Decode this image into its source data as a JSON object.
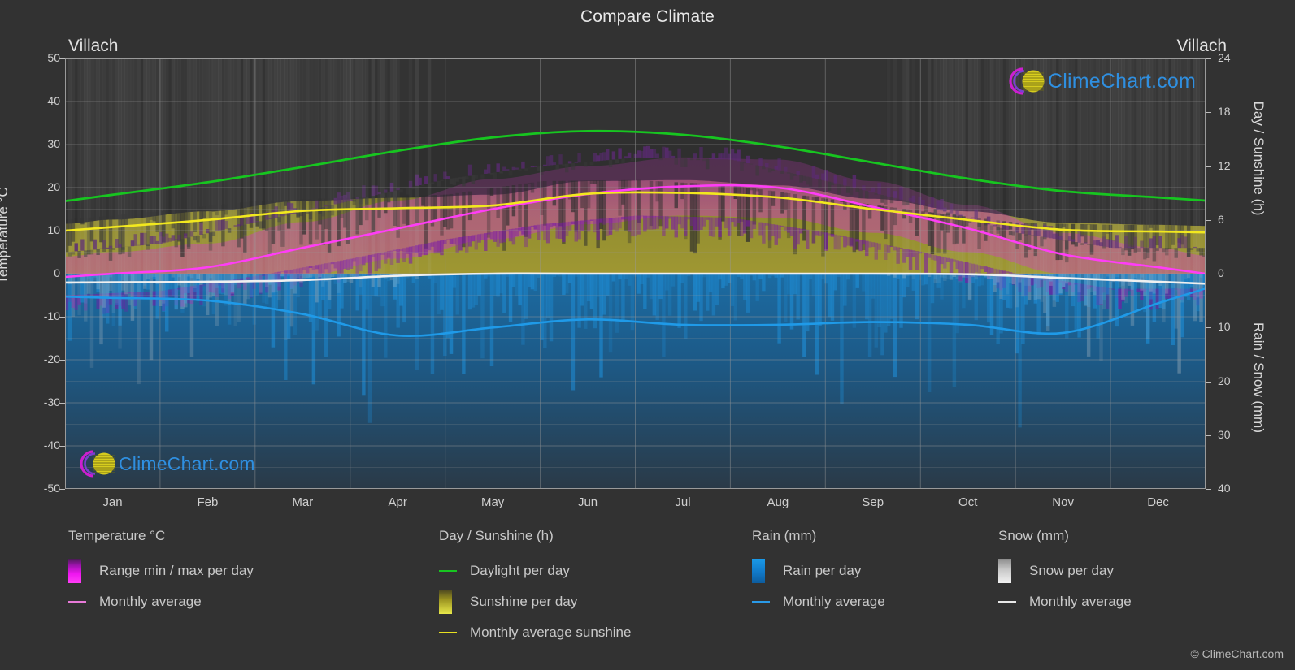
{
  "header": {
    "title": "Compare Climate",
    "city_left": "Villach",
    "city_right": "Villach"
  },
  "logo": {
    "text": "ClimeChart.com",
    "copyright": "© ClimeChart.com"
  },
  "axes": {
    "left_title": "Temperature °C",
    "right_top_title": "Day / Sunshine (h)",
    "right_bottom_title": "Rain / Snow (mm)",
    "left_ticks": [
      "50",
      "40",
      "30",
      "20",
      "10",
      "0",
      "-10",
      "-20",
      "-30",
      "-40",
      "-50"
    ],
    "right_top_ticks": [
      "24",
      "18",
      "12",
      "6",
      "0"
    ],
    "right_bottom_ticks": [
      "10",
      "20",
      "30",
      "40"
    ],
    "x_ticks": [
      "Jan",
      "Feb",
      "Mar",
      "Apr",
      "May",
      "Jun",
      "Jul",
      "Aug",
      "Sep",
      "Oct",
      "Nov",
      "Dec"
    ]
  },
  "legend": {
    "groups": [
      {
        "title": "Temperature °C",
        "items": [
          {
            "label": "Range min / max per day",
            "swatch": "gradient",
            "style": "sw-temp",
            "color": "#e81ce8"
          },
          {
            "label": "Monthly average",
            "swatch": "line",
            "style": "",
            "color": "#e87ad8"
          }
        ]
      },
      {
        "title": "Day / Sunshine (h)",
        "items": [
          {
            "label": "Daylight per day",
            "swatch": "line",
            "style": "",
            "color": "#17c520"
          },
          {
            "label": "Sunshine per day",
            "swatch": "gradient",
            "style": "sw-sun",
            "color": "#e8e84a"
          },
          {
            "label": "Monthly average sunshine",
            "swatch": "line",
            "style": "",
            "color": "#e8e020"
          }
        ]
      },
      {
        "title": "Rain (mm)",
        "items": [
          {
            "label": "Rain per day",
            "swatch": "gradient",
            "style": "sw-rain",
            "color": "#1b8fe0"
          },
          {
            "label": "Monthly average",
            "swatch": "line",
            "style": "",
            "color": "#2a9ae8"
          }
        ]
      },
      {
        "title": "Snow (mm)",
        "items": [
          {
            "label": "Snow per day",
            "swatch": "gradient",
            "style": "sw-snow",
            "color": "#d8d8d8"
          },
          {
            "label": "Monthly average",
            "swatch": "line",
            "style": "",
            "color": "#e8e8e8"
          }
        ]
      }
    ]
  },
  "colors": {
    "background": "#323232",
    "plot_bg": "#333333",
    "grid": "#8f8f8f",
    "text": "#d0d0d0",
    "daylight": "#17c520",
    "sunshine_avg": "#f2e81e",
    "temp_avg": "#ff3df7",
    "rain_avg": "#1f9ae8",
    "snow_avg": "#f0f0f0",
    "logo_blue": "#2f8fe0",
    "logo_magenta": "#cc1fd0",
    "logo_yellow": "#d6cc1e"
  },
  "chart_data": {
    "type": "line",
    "title": "Compare Climate",
    "subtitle": "Villach",
    "xlabel": "",
    "ylabel": "Temperature °C",
    "ylim": [
      -50,
      50
    ],
    "y2_top_label": "Day / Sunshine (h)",
    "y2_top_lim": [
      0,
      24
    ],
    "y2_bottom_label": "Rain / Snow (mm)",
    "y2_bottom_lim": [
      0,
      40
    ],
    "grid": true,
    "legend_position": "below",
    "categories": [
      "Jan",
      "Feb",
      "Mar",
      "Apr",
      "May",
      "Jun",
      "Jul",
      "Aug",
      "Sep",
      "Oct",
      "Nov",
      "Dec"
    ],
    "series": [
      {
        "name": "Daylight per day",
        "unit": "h",
        "axis": "right_top",
        "color": "#17c520",
        "values": [
          8.8,
          10.2,
          11.9,
          13.7,
          15.2,
          15.9,
          15.5,
          14.2,
          12.4,
          10.6,
          9.2,
          8.5
        ]
      },
      {
        "name": "Monthly average sunshine",
        "unit": "h",
        "axis": "right_top",
        "color": "#f2e81e",
        "values": [
          5.2,
          6.0,
          7.0,
          7.3,
          7.6,
          8.9,
          9.0,
          8.5,
          7.2,
          6.0,
          4.9,
          4.7
        ]
      },
      {
        "name": "Monthly average temperature",
        "unit": "°C",
        "axis": "left",
        "color": "#ff3df7",
        "values": [
          0.0,
          1.5,
          6.0,
          10.5,
          15.0,
          18.5,
          20.3,
          20.0,
          15.5,
          10.5,
          4.5,
          1.5
        ]
      },
      {
        "name": "Monthly average rain",
        "unit": "mm",
        "axis": "right_bottom",
        "color": "#1f9ae8",
        "values": [
          4.5,
          5.0,
          7.5,
          11.5,
          10.0,
          8.5,
          9.5,
          9.5,
          9.0,
          9.5,
          11.0,
          5.5
        ]
      },
      {
        "name": "Monthly average snow",
        "unit": "mm",
        "axis": "right_bottom",
        "color": "#f0f0f0",
        "values": [
          1.6,
          1.5,
          1.2,
          0.4,
          0.0,
          0.0,
          0.0,
          0.0,
          0.0,
          0.1,
          0.8,
          1.5
        ]
      },
      {
        "name": "Temperature range max per day",
        "unit": "°C",
        "axis": "left",
        "color": "#e81ce8",
        "values": [
          5.0,
          7.0,
          12.0,
          17.0,
          22.0,
          25.0,
          27.0,
          26.5,
          21.5,
          16.0,
          9.5,
          6.0
        ]
      },
      {
        "name": "Temperature range min per day",
        "unit": "°C",
        "axis": "left",
        "color": "#a013b0",
        "values": [
          -5.0,
          -4.0,
          -0.5,
          3.5,
          8.0,
          11.5,
          13.5,
          13.0,
          9.5,
          5.0,
          0.0,
          -3.5
        ]
      }
    ]
  }
}
